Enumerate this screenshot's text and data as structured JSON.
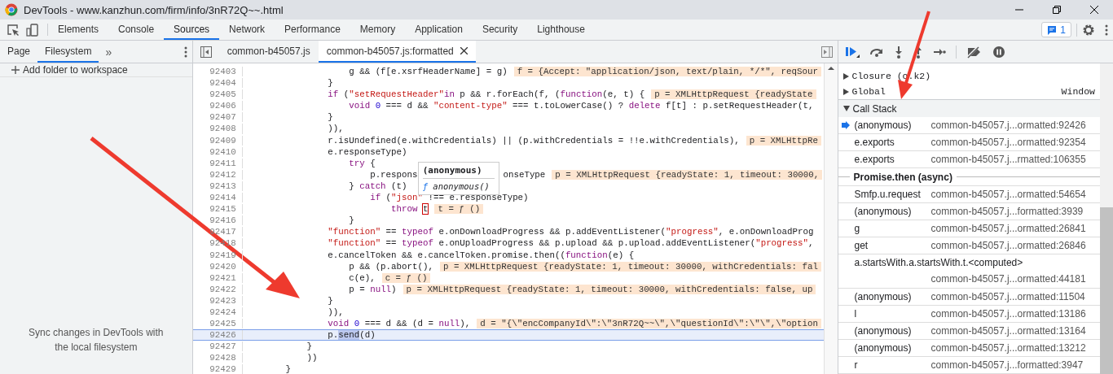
{
  "window": {
    "title": "DevTools - www.kanzhun.com/firm/info/3nR72Q~~.html"
  },
  "panel_tabs": [
    {
      "label": "Elements",
      "selected": false
    },
    {
      "label": "Console",
      "selected": false
    },
    {
      "label": "Sources",
      "selected": true
    },
    {
      "label": "Network",
      "selected": false
    },
    {
      "label": "Performance",
      "selected": false
    },
    {
      "label": "Memory",
      "selected": false
    },
    {
      "label": "Application",
      "selected": false
    },
    {
      "label": "Security",
      "selected": false
    },
    {
      "label": "Lighthouse",
      "selected": false
    }
  ],
  "issues_badge": "1",
  "navigator": {
    "tabs": [
      {
        "label": "Page",
        "selected": false
      },
      {
        "label": "Filesystem",
        "selected": true
      }
    ],
    "more": "»",
    "add_folder": "Add folder to workspace",
    "hint": "Sync changes in DevTools with the local filesystem"
  },
  "editor": {
    "tabs": [
      {
        "label": "common-b45057.js",
        "selected": false,
        "closable": false
      },
      {
        "label": "common-b45057.js:formatted",
        "selected": true,
        "closable": true
      }
    ],
    "lines": [
      {
        "num": "92403",
        "current": false,
        "code": [
          {
            "kind": "plain",
            "text": "                    g && (f[e.xsrfHeaderName] = g)"
          }
        ],
        "hint": "f = {Accept: \"application/json, text/plain, */*\", reqSour"
      },
      {
        "num": "92404",
        "current": false,
        "code": [
          {
            "kind": "plain",
            "text": "                }"
          }
        ]
      },
      {
        "num": "92405",
        "current": false,
        "code": [
          {
            "kind": "keyword",
            "text": "                if"
          },
          {
            "kind": "plain",
            "text": " ("
          },
          {
            "kind": "string",
            "text": "\"setRequestHeader\""
          },
          {
            "kind": "keyword",
            "text": "in"
          },
          {
            "kind": "plain",
            "text": " p && r.forEach(f, ("
          },
          {
            "kind": "keyword",
            "text": "function"
          },
          {
            "kind": "plain",
            "text": "(e, t) {"
          }
        ],
        "hint": "p = XMLHttpRequest {readyState"
      },
      {
        "num": "92406",
        "current": false,
        "code": [
          {
            "kind": "keyword",
            "text": "                    void "
          },
          {
            "kind": "number",
            "text": "0"
          },
          {
            "kind": "plain",
            "text": " === d && "
          },
          {
            "kind": "string",
            "text": "\"content-type\""
          },
          {
            "kind": "plain",
            "text": " === t.toLowerCase() ? "
          },
          {
            "kind": "keyword",
            "text": "delete"
          },
          {
            "kind": "plain",
            "text": " f[t] : p.setRequestHeader(t,"
          }
        ]
      },
      {
        "num": "92407",
        "current": false,
        "code": [
          {
            "kind": "plain",
            "text": "                }"
          }
        ]
      },
      {
        "num": "92408",
        "current": false,
        "code": [
          {
            "kind": "plain",
            "text": "                )),"
          }
        ]
      },
      {
        "num": "92409",
        "current": false,
        "code": [
          {
            "kind": "plain",
            "text": "                r.isUndefined(e.withCredentials) || (p.withCredentials = !!e.withCredentials),"
          }
        ],
        "hint": "p = XMLHttpRe"
      },
      {
        "num": "92410",
        "current": false,
        "code": [
          {
            "kind": "plain",
            "text": "                e.responseType)"
          }
        ]
      },
      {
        "num": "92411",
        "current": false,
        "code": [
          {
            "kind": "keyword",
            "text": "                    try"
          },
          {
            "kind": "plain",
            "text": " {"
          }
        ]
      },
      {
        "num": "92412",
        "current": false,
        "code": [
          {
            "kind": "plain",
            "text": "                        p.respons"
          },
          {
            "kind": "after_tooltip",
            "text": "onseType"
          }
        ],
        "hint": "p = XMLHttpRequest {readyState: 1, timeout: 30000,"
      },
      {
        "num": "92413",
        "current": false,
        "code": [
          {
            "kind": "plain",
            "text": "                    } "
          },
          {
            "kind": "keyword",
            "text": "catch"
          },
          {
            "kind": "plain",
            "text": " (t)"
          }
        ]
      },
      {
        "num": "92414",
        "current": false,
        "code": [
          {
            "kind": "keyword",
            "text": "                        if"
          },
          {
            "kind": "plain",
            "text": " ("
          },
          {
            "kind": "string",
            "text": "\"json\""
          },
          {
            "kind": "plain",
            "text": " !== e.responseType)"
          }
        ]
      },
      {
        "num": "92415",
        "current": false,
        "code": [
          {
            "kind": "keyword",
            "text": "                            throw "
          },
          {
            "kind": "boxed",
            "text": "t"
          }
        ],
        "hint": "t = ƒ ()"
      },
      {
        "num": "92416",
        "current": false,
        "code": [
          {
            "kind": "plain",
            "text": "                    }"
          }
        ]
      },
      {
        "num": "92417",
        "current": false,
        "code": [
          {
            "kind": "string",
            "text": "                \"function\""
          },
          {
            "kind": "plain",
            "text": " == "
          },
          {
            "kind": "keyword",
            "text": "typeof"
          },
          {
            "kind": "plain",
            "text": " e.onDownloadProgress && p.addEventListener("
          },
          {
            "kind": "string",
            "text": "\"progress\""
          },
          {
            "kind": "plain",
            "text": ", e.onDownloadProg"
          }
        ]
      },
      {
        "num": "92418",
        "current": false,
        "code": [
          {
            "kind": "string",
            "text": "                \"function\""
          },
          {
            "kind": "plain",
            "text": " == "
          },
          {
            "kind": "keyword",
            "text": "typeof"
          },
          {
            "kind": "plain",
            "text": " e.onUploadProgress && p.upload && p.upload.addEventListener("
          },
          {
            "kind": "string",
            "text": "\"progress\""
          },
          {
            "kind": "plain",
            "text": ","
          }
        ]
      },
      {
        "num": "92419",
        "current": false,
        "code": [
          {
            "kind": "plain",
            "text": "                e.cancelToken && e.cancelToken.promise.then(("
          },
          {
            "kind": "keyword",
            "text": "function"
          },
          {
            "kind": "plain",
            "text": "(e) {"
          }
        ]
      },
      {
        "num": "92420",
        "current": false,
        "code": [
          {
            "kind": "plain",
            "text": "                    p && (p.abort(),"
          }
        ],
        "hint": "p = XMLHttpRequest {readyState: 1, timeout: 30000, withCredentials: fal"
      },
      {
        "num": "92421",
        "current": false,
        "code": [
          {
            "kind": "plain",
            "text": "                    c(e),"
          }
        ],
        "hint": "c = ƒ ()"
      },
      {
        "num": "92422",
        "current": false,
        "code": [
          {
            "kind": "plain",
            "text": "                    p = "
          },
          {
            "kind": "keyword",
            "text": "null"
          },
          {
            "kind": "plain",
            "text": ")"
          }
        ],
        "hint": "p = XMLHttpRequest {readyState: 1, timeout: 30000, withCredentials: false, up"
      },
      {
        "num": "92423",
        "current": false,
        "code": [
          {
            "kind": "plain",
            "text": "                }"
          }
        ]
      },
      {
        "num": "92424",
        "current": false,
        "code": [
          {
            "kind": "plain",
            "text": "                )),"
          }
        ]
      },
      {
        "num": "92425",
        "current": false,
        "code": [
          {
            "kind": "keyword",
            "text": "                void "
          },
          {
            "kind": "number",
            "text": "0"
          },
          {
            "kind": "plain",
            "text": " === d && (d = "
          },
          {
            "kind": "keyword",
            "text": "null"
          },
          {
            "kind": "plain",
            "text": "),"
          }
        ],
        "hint": "d = \"{\\\"encCompanyId\\\":\\\"3nR72Q~~\\\",\\\"questionId\\\":\\\"\\\",\\\"option"
      },
      {
        "num": "92426",
        "current": true,
        "code": [
          {
            "kind": "plain",
            "text": "                p."
          },
          {
            "kind": "match",
            "text": "send"
          },
          {
            "kind": "plain",
            "text": "(d)"
          }
        ]
      },
      {
        "num": "92427",
        "current": false,
        "code": [
          {
            "kind": "plain",
            "text": "            }"
          }
        ]
      },
      {
        "num": "92428",
        "current": false,
        "code": [
          {
            "kind": "plain",
            "text": "            ))"
          }
        ]
      },
      {
        "num": "92429",
        "current": false,
        "code": [
          {
            "kind": "plain",
            "text": "        }"
          }
        ]
      }
    ],
    "tooltip": {
      "title": "(anonymous)",
      "glyph": "ƒ",
      "value": "anonymous()"
    }
  },
  "scope": [
    {
      "label": "Closure (o.k2)"
    },
    {
      "label": "Global",
      "value": "Window"
    }
  ],
  "call_stack": {
    "title": "Call Stack",
    "expanded": true,
    "frames": [
      {
        "kind": "frame",
        "name": "(anonymous)",
        "location": "common-b45057.j...ormatted:92426",
        "selected": true
      },
      {
        "kind": "frame",
        "name": "e.exports",
        "location": "common-b45057.j...ormatted:92354",
        "selected": false
      },
      {
        "kind": "frame",
        "name": "e.exports",
        "location": "common-b45057.j...rmatted:106355",
        "selected": false
      },
      {
        "kind": "async",
        "name": "Promise.then (async)"
      },
      {
        "kind": "frame",
        "name": "Smfp.u.request",
        "location": "common-b45057.j...ormatted:54654",
        "selected": false
      },
      {
        "kind": "frame",
        "name": "(anonymous)",
        "location": "common-b45057.j...formatted:3939",
        "selected": false
      },
      {
        "kind": "frame",
        "name": "g",
        "location": "common-b45057.j...ormatted:26841",
        "selected": false
      },
      {
        "kind": "frame",
        "name": "get",
        "location": "common-b45057.j...ormatted:26846",
        "selected": false
      },
      {
        "kind": "wide",
        "name": "a.startsWith.a.startsWith.t.<computed>",
        "location": "common-b45057.j...ormatted:44181",
        "selected": false
      },
      {
        "kind": "frame",
        "name": "(anonymous)",
        "location": "common-b45057.j...ormatted:11504",
        "selected": false
      },
      {
        "kind": "frame",
        "name": "l",
        "location": "common-b45057.j...ormatted:13186",
        "selected": false
      },
      {
        "kind": "frame",
        "name": "(anonymous)",
        "location": "common-b45057.j...ormatted:13164",
        "selected": false
      },
      {
        "kind": "frame",
        "name": "(anonymous)",
        "location": "common-b45057.j...ormatted:13212",
        "selected": false
      },
      {
        "kind": "frame",
        "name": "r",
        "location": "common-b45057.j...formatted:3947",
        "selected": false
      }
    ]
  }
}
